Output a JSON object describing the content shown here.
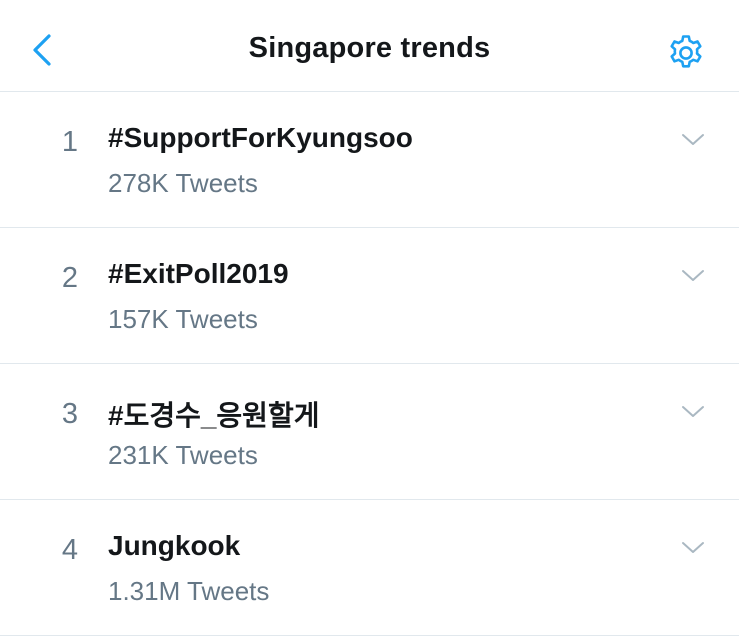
{
  "header": {
    "title": "Singapore trends",
    "back_icon": "chevron-left-icon",
    "settings_icon": "gear-icon"
  },
  "colors": {
    "accent": "#1da1f2",
    "text_primary": "#14171a",
    "text_secondary": "#657786",
    "divider": "#e1e8ed"
  },
  "trends": [
    {
      "rank": "1",
      "name": "#SupportForKyungsoo",
      "count": "278K Tweets"
    },
    {
      "rank": "2",
      "name": "#ExitPoll2019",
      "count": "157K Tweets"
    },
    {
      "rank": "3",
      "name": "#도경수_응원할게",
      "count": "231K Tweets"
    },
    {
      "rank": "4",
      "name": "Jungkook",
      "count": "1.31M Tweets"
    }
  ]
}
